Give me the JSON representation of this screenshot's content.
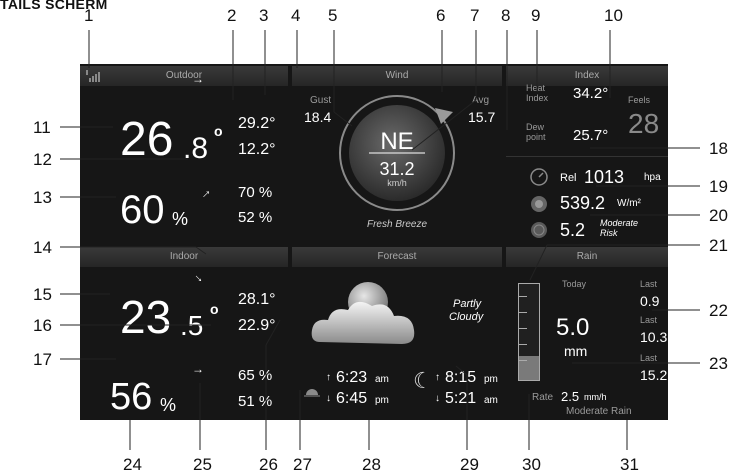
{
  "page_title": "TAILS SCHERM",
  "callouts": [
    "1",
    "2",
    "3",
    "4",
    "5",
    "6",
    "7",
    "8",
    "9",
    "10",
    "11",
    "12",
    "13",
    "14",
    "15",
    "16",
    "17",
    "18",
    "19",
    "20",
    "21",
    "22",
    "23",
    "24",
    "25",
    "26",
    "27",
    "28",
    "29",
    "30",
    "31"
  ],
  "outdoor": {
    "title": "Outdoor",
    "temp": "26",
    "temp_dec": ".8",
    "deg": "o",
    "max": "29.2°",
    "min": "12.2°",
    "humidity": "60",
    "pct": "%",
    "hum_max": "70 %",
    "hum_min": "52 %"
  },
  "wind": {
    "title": "Wind",
    "gust_label": "Gust",
    "gust": "18.4",
    "avg_label": "Avg",
    "avg": "15.7",
    "direction": "NE",
    "speed": "31.2",
    "unit": "km/h",
    "description": "Fresh Breeze"
  },
  "index": {
    "title": "Index",
    "heat_label_1": "Heat",
    "heat_label_2": "Index",
    "heat": "34.2°",
    "dew_label_1": "Dew",
    "dew_label_2": "point",
    "dew": "25.7°",
    "feels_label": "Feels",
    "feels": "28",
    "rel_label": "Rel",
    "pressure": "1013",
    "pressure_unit": "hpa",
    "solar": "539.2",
    "solar_unit": "W/m²",
    "uv": "5.2",
    "uv_risk_1": "Moderate",
    "uv_risk_2": "Risk"
  },
  "indoor": {
    "title": "Indoor",
    "temp": "23",
    "temp_dec": ".5",
    "deg": "o",
    "max": "28.1°",
    "min": "22.9°",
    "humidity": "56",
    "pct": "%",
    "hum_max": "65 %",
    "hum_min": "51 %"
  },
  "forecast": {
    "title": "Forecast",
    "text_1": "Partly",
    "text_2": "Cloudy",
    "sunrise": "6:23",
    "sunrise_ampm": "am",
    "sunset": "6:45",
    "sunset_ampm": "pm",
    "moonrise": "8:15",
    "moonrise_ampm": "pm",
    "moonset": "5:21",
    "moonset_ampm": "am"
  },
  "rain": {
    "title": "Rain",
    "today_label": "Today",
    "today": "5.0",
    "unit": "mm",
    "last_1_label": "Last",
    "last_1": "0.9",
    "last_2_label": "Last",
    "last_2": "10.3",
    "last_3_label": "Last",
    "last_3": "15.2",
    "rate_label": "Rate",
    "rate": "2.5",
    "rate_unit": "mm/h",
    "rate_desc": "Moderate Rain",
    "gauge_fill_fraction": 0.25
  }
}
